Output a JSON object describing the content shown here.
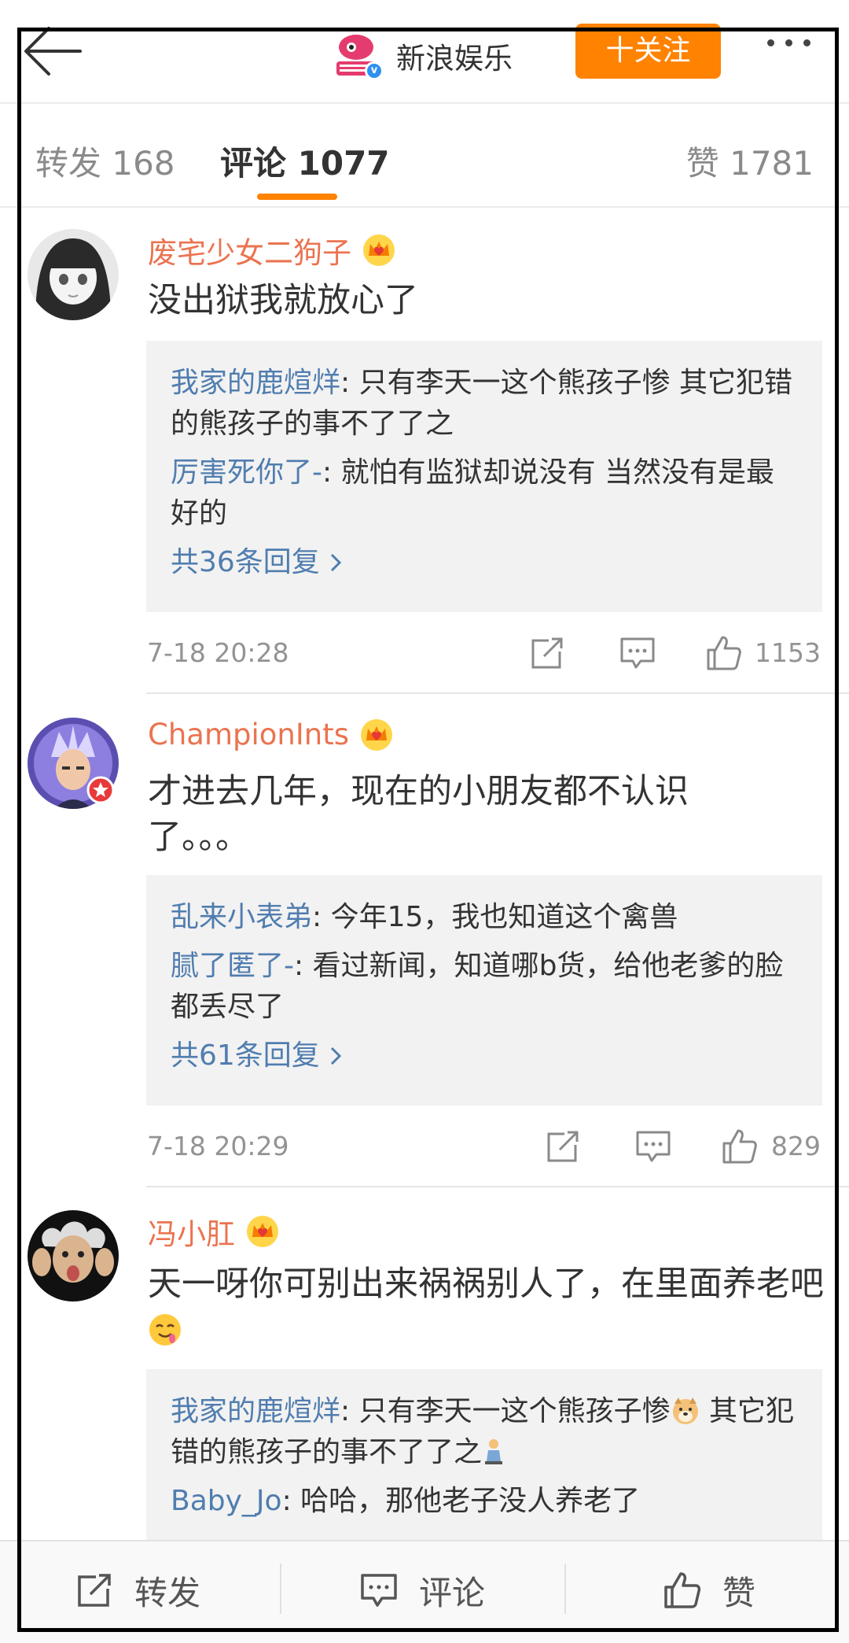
{
  "header": {
    "account_name": "新浪娱乐",
    "follow_label": "十关注",
    "brand_color": "#ff8200",
    "back_icon": "back-arrow-icon",
    "more_icon": "more-dots-icon"
  },
  "tabs": [
    {
      "label": "转发 168"
    },
    {
      "label": "评论 1077"
    },
    {
      "label": "赞 1781"
    }
  ],
  "comments": [
    {
      "username": "废宅少女二狗子",
      "text": "没出狱我就放心了",
      "replies": [
        {
          "author": "我家的鹿煊烊",
          "text": ": 只有李天一这个熊孩子惨 其它犯错的熊孩子的事不了了之"
        },
        {
          "author": "厉害死你了-",
          "text": ": 就怕有监狱却说没有 当然没有是最好的"
        }
      ],
      "more_replies": "共36条回复",
      "time": "7-18 20:28",
      "likes": "1153"
    },
    {
      "username": "ChampionInts",
      "text": "才进去几年，现在的小朋友都不认识了。。。",
      "replies": [
        {
          "author": "乱来小表弟",
          "text": ": 今年15，我也知道这个禽兽"
        },
        {
          "author": "腻了匿了-",
          "text": ": 看过新闻，知道哪b货，给他老爹的脸都丢尽了"
        }
      ],
      "more_replies": "共61条回复",
      "time": "7-18 20:29",
      "likes": "829"
    },
    {
      "username": "冯小肛",
      "text": "天一呀你可别出来祸祸别人了，在里面养老吧",
      "emoji": "drooling-face-emoji",
      "replies": [
        {
          "author": "我家的鹿煊烊",
          "text": ": 只有李天一这个熊孩子惨",
          "text_after_emoji": " 其它犯错的熊孩子的事不了了之"
        },
        {
          "author": "Baby_Jo",
          "text": ": 哈哈，那他老子没人养老了"
        }
      ]
    }
  ],
  "bottom_bar": {
    "repost_label": "转发",
    "comment_label": "评论",
    "like_label": "赞"
  },
  "colors": {
    "username": "#eb7350",
    "reply_author": "#507daf",
    "accent": "#ff8200"
  }
}
